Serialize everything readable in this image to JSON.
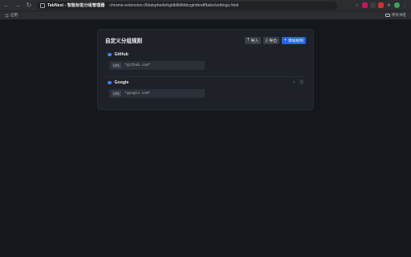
{
  "browser": {
    "tab_origin": "TabNest - 智能标签分组管理器",
    "url": "chrome-extension://ldaiophedehgldldlkfkkbcgimbndf/tabs/settings.html",
    "bookmarks": {
      "apps_label": "应用",
      "all_bookmarks_label": "所有书签"
    }
  },
  "panel": {
    "title": "自定义分组规则",
    "import_label": "导入",
    "export_label": "导出",
    "add_rule_label": "添加规则"
  },
  "rules": [
    {
      "name": "GitHub",
      "tag": "URL",
      "pattern": "*github.com*",
      "color": "#3b82f6"
    },
    {
      "name": "Google",
      "tag": "URL",
      "pattern": "*google.com*",
      "color": "#3b82f6"
    }
  ],
  "colors": {
    "accent": "#2563eb",
    "background": "#14171c",
    "panel": "#1e2228"
  }
}
